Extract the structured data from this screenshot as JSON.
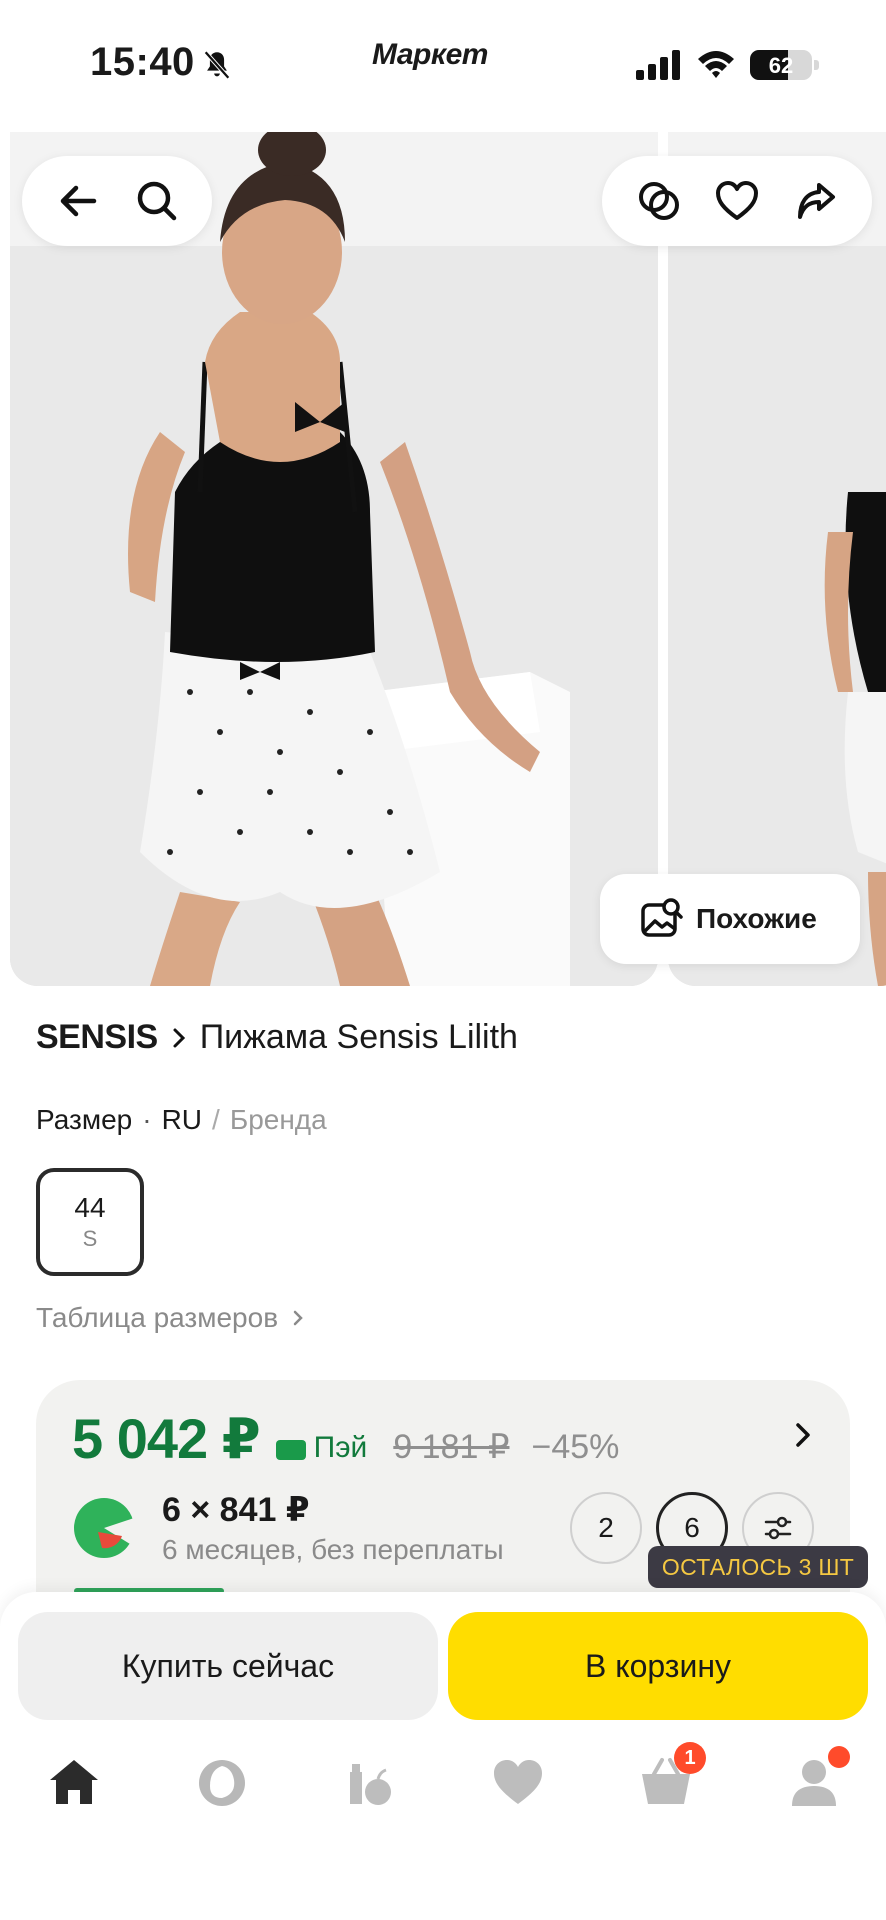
{
  "status_bar": {
    "time": "15:40",
    "app_logo": "Маркет",
    "battery_level": 62,
    "battery_label": "62",
    "icons": [
      "bell-muted-icon",
      "signal-icon",
      "wifi-icon",
      "battery-icon"
    ]
  },
  "gallery": {
    "left_pill_icons": [
      "back-arrow-icon",
      "search-icon"
    ],
    "right_pill_icons": [
      "compare-icon",
      "heart-icon",
      "share-icon"
    ],
    "similar_label": "Похожие",
    "similar_icon": "image-search-icon"
  },
  "product": {
    "brand": "SENSIS",
    "name": "Пижама Sensis Lilith",
    "size_label": "Размер",
    "size_system": "RU",
    "size_alt": "Бренда",
    "selected_size": {
      "main": "44",
      "sub": "S"
    },
    "size_table_link": "Таблица размеров"
  },
  "price_card": {
    "price": "5 042 ₽",
    "pay_label": "Пэй",
    "old_price": "9 181 ₽",
    "discount": "−45%",
    "split_main": "6 × 841 ₽",
    "split_sub": "6 месяцев, без переплаты",
    "terms": [
      "2",
      "6"
    ],
    "selected_term": "6",
    "stock_badge": "ОСТАЛОСЬ 3 ШТ",
    "colors": {
      "price_green": "#127a3c",
      "card_bg": "#f2f2f0"
    }
  },
  "actions": {
    "buy_now": "Купить сейчас",
    "to_cart": "В корзину",
    "colors": {
      "cart_yellow": "#ffdd00",
      "buy_grey": "#efefef"
    }
  },
  "tabbar": {
    "items": [
      {
        "name": "home",
        "icon": "home-icon",
        "active": true
      },
      {
        "name": "alice",
        "icon": "alice-icon"
      },
      {
        "name": "grocery",
        "icon": "grocery-icon"
      },
      {
        "name": "favorites",
        "icon": "heart-icon"
      },
      {
        "name": "cart",
        "icon": "cart-icon",
        "badge": "1"
      },
      {
        "name": "profile",
        "icon": "profile-icon",
        "has_dot": true
      }
    ]
  }
}
